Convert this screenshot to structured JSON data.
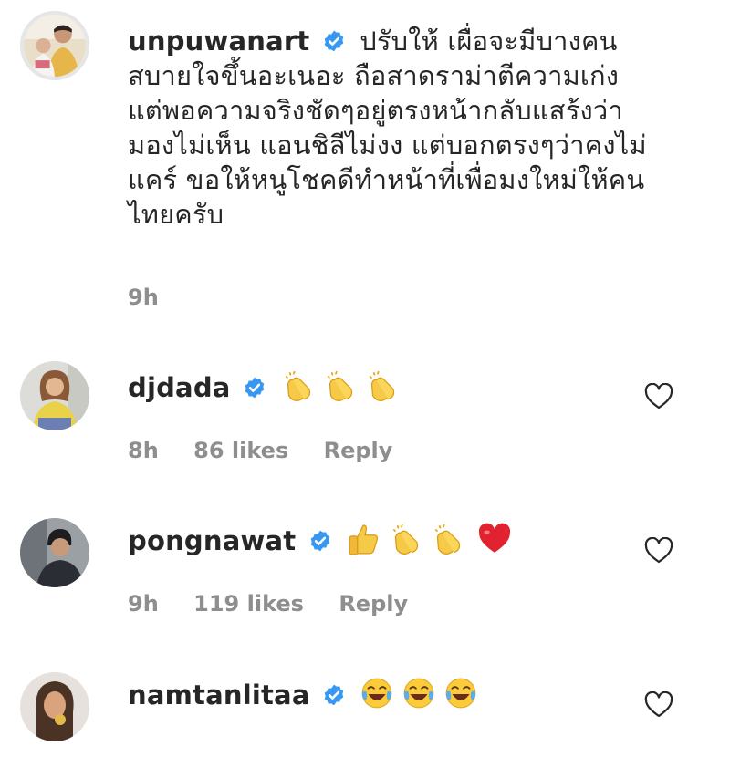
{
  "comments": [
    {
      "username": "unpuwanart",
      "verified": true,
      "text": "ปรับให้ เผื่อจะมีบางคนสบายใจขึ้นอะเนอะ ถือสาดราม่าตีความเก่ง แต่พอความจริงชัดๆอยู่ตรงหน้ากลับแสร้งว่ามองไม่เห็น แอนชิลีไม่งง แต่บอกตรงๆว่าคงไม่แคร์ ขอให้หนูโชคดีทำหน้าที่เพื่อมงใหม่ให้คนไทยครับ",
      "time": "9h"
    },
    {
      "username": "djdada",
      "verified": true,
      "emojis": [
        "clapping-hands",
        "clapping-hands",
        "clapping-hands"
      ],
      "time": "8h",
      "likes": "86 likes",
      "reply": "Reply"
    },
    {
      "username": "pongnawat",
      "verified": true,
      "emojis": [
        "thumbs-up",
        "clapping-hands",
        "clapping-hands",
        "red-heart"
      ],
      "time": "9h",
      "likes": "119 likes",
      "reply": "Reply"
    },
    {
      "username": "namtanlitaa",
      "verified": true,
      "emojis": [
        "tears-of-joy-face",
        "tears-of-joy-face",
        "tears-of-joy-face"
      ]
    }
  ],
  "colors": {
    "verified_badge": "#3897f0",
    "meta_text": "#8e8e8e",
    "username": "#262626"
  }
}
